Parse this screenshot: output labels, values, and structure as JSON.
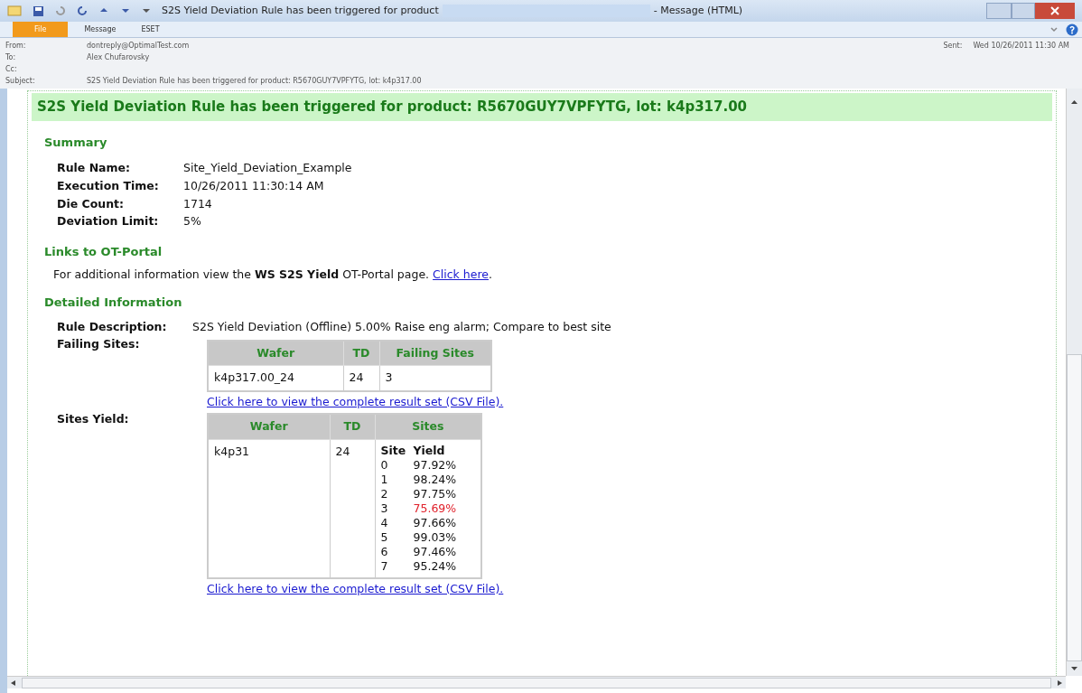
{
  "window": {
    "title": "S2S Yield Deviation Rule has been triggered for product",
    "title_suffix": "- Message (HTML)"
  },
  "tabs": [
    {
      "label": "File",
      "selected": true
    },
    {
      "label": "Message",
      "selected": false
    },
    {
      "label": "ESET",
      "selected": false
    }
  ],
  "header": {
    "fields": [
      {
        "label": "From:",
        "value": "dontreply@OptimalTest.com"
      },
      {
        "label": "To:",
        "value": "Alex Chufarovsky"
      },
      {
        "label": "Cc:"
      },
      {
        "label": "Subject:",
        "value": "S2S Yield Deviation Rule has been triggered for product: R5670GUY7VPFYTG, lot: k4p317.00"
      }
    ],
    "sent_label": "Sent:",
    "sent_value": "Wed 10/26/2011 11:30 AM"
  },
  "body": {
    "banner": "S2S Yield Deviation Rule has been triggered for product: R5670GUY7VPFYTG, lot: k4p317.00",
    "summary": {
      "heading": "Summary",
      "rows": [
        {
          "label": "Rule Name:",
          "value": "Site_Yield_Deviation_Example"
        },
        {
          "label": "Execution Time:",
          "value": "10/26/2011 11:30:14 AM"
        },
        {
          "label": "Die Count:",
          "value": "1714"
        },
        {
          "label": "Deviation Limit:",
          "value": "5%"
        }
      ]
    },
    "links": {
      "heading": "Links to OT-Portal",
      "text": "For additional information view the **WS S2S Yield** OT-Portal page.",
      "link": "Click here",
      "after": "."
    },
    "detail": {
      "heading": "Detailed Information",
      "description_label": "Rule Description:",
      "description": "S2S Yield Deviation (Offline) 5.00% Raise eng alarm; Compare to best site",
      "failing": {
        "label": "Failing Sites:",
        "columns": [
          "Wafer",
          "TD",
          "Failing Sites"
        ],
        "rows": [
          [
            "k4p317.00_24",
            "24",
            "3"
          ]
        ],
        "link": "Click here to view the complete result set (CSV File)."
      },
      "sites": {
        "label": "Sites Yield:",
        "columns": [
          "Wafer",
          "TD",
          "Sites"
        ],
        "wafer": "k4p31",
        "td": "24",
        "sub_columns": [
          "Site",
          "Yield"
        ],
        "rows": [
          {
            "site": "0",
            "yield": "97.92%",
            "flagged": false
          },
          {
            "site": "1",
            "yield": "98.24%",
            "flagged": false
          },
          {
            "site": "2",
            "yield": "97.75%",
            "flagged": false
          },
          {
            "site": "3",
            "yield": "75.69%",
            "flagged": true
          },
          {
            "site": "4",
            "yield": "97.66%",
            "flagged": false
          },
          {
            "site": "5",
            "yield": "99.03%",
            "flagged": false
          },
          {
            "site": "6",
            "yield": "97.46%",
            "flagged": false
          },
          {
            "site": "7",
            "yield": "95.24%",
            "flagged": false
          }
        ],
        "link": "Click here to view the complete result set (CSV File)."
      }
    }
  }
}
